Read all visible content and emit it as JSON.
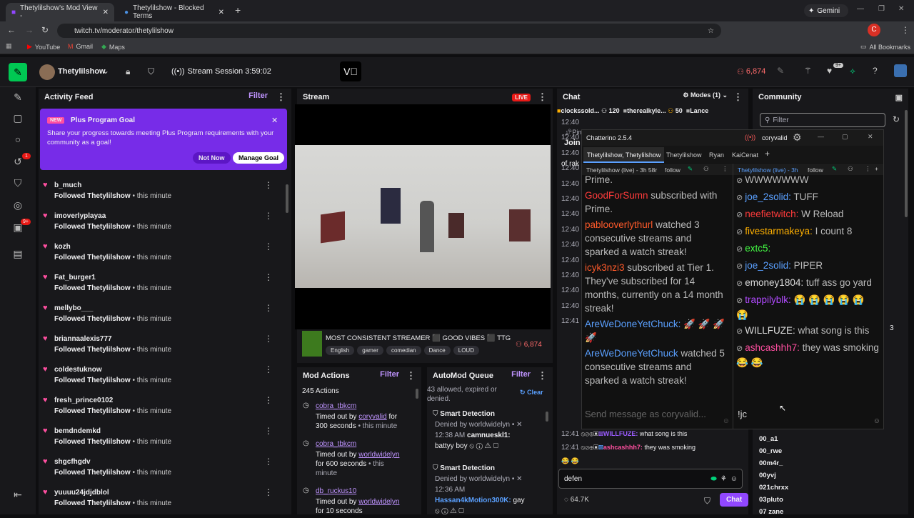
{
  "browser": {
    "tabs": [
      {
        "label": "Thetylilshow's Mod View -"
      },
      {
        "label": "Thetylilshow - Blocked Terms"
      }
    ],
    "url": "twitch.tv/moderator/thetylilshow",
    "gemini": "Gemini",
    "bookmarks": [
      "YouTube",
      "Gmail",
      "Maps"
    ],
    "all_bookmarks": "All Bookmarks",
    "profile_initial": "C"
  },
  "topnav": {
    "channel": "Thetylilshow",
    "session": "Stream Session 3:59:02",
    "viewers": "6,874",
    "notif_badge": "9+"
  },
  "rail": {
    "badge1": "1",
    "badge2": "9+"
  },
  "activity": {
    "title": "Activity Feed",
    "filter": "Filter",
    "goal_badge": "NEW",
    "goal_title": "Plus Program Goal",
    "goal_text": "Share your progress towards meeting Plus Program requirements with your community as a goal!",
    "not_now": "Not Now",
    "manage": "Manage Goal",
    "action": "Followed",
    "target": "Thetylilshow",
    "time": "• this minute",
    "items": [
      {
        "name": "b_much"
      },
      {
        "name": "imoverlyplayaa"
      },
      {
        "name": "kozh"
      },
      {
        "name": "Fat_burger1"
      },
      {
        "name": "mellybo___"
      },
      {
        "name": "briannaalexis777"
      },
      {
        "name": "coldestuknow"
      },
      {
        "name": "fresh_prince0102"
      },
      {
        "name": "bemdndemkd"
      },
      {
        "name": "shgcfhgdv"
      },
      {
        "name": "yuuuu24jdjdblol"
      }
    ]
  },
  "stream": {
    "title": "Stream",
    "live": "LIVE",
    "stream_title": "MOST CONSISTENT STREAMER ⬛ GOOD VIBES ⬛ TTG",
    "tags": [
      "English",
      "gamer",
      "comedian",
      "Dance",
      "LOUD"
    ],
    "viewers": "6,874"
  },
  "modactions": {
    "title": "Mod Actions",
    "filter": "Filter",
    "count": "245 Actions",
    "items": [
      {
        "user": "cobra_tbkcm",
        "l1": "Timed out by",
        "by": "coryvalid",
        "l1b": "for",
        "l2": "300 seconds",
        "time": "• this minute"
      },
      {
        "user": "cobra_tbkcm",
        "l1": "Timed out by",
        "by": "worldwidelyn",
        "l2": "for 600 seconds",
        "time": "• this",
        "l3": "minute"
      },
      {
        "user": "db_ruckus10",
        "l1": "Timed out by",
        "by": "worldwidelyn",
        "l2": "for 10 seconds"
      }
    ]
  },
  "automod": {
    "title": "AutoMod Queue",
    "filter": "Filter",
    "summary1": "43 allowed, expired or",
    "summary2": "denied.",
    "clear": "Clear",
    "items": [
      {
        "title": "Smart Detection",
        "denied": "Denied by worldwidelyn •",
        "time": "12:38 AM",
        "user": "camnueskl1:",
        "msg": "battyy boy"
      },
      {
        "title": "Smart Detection",
        "denied": "Denied by worldwidelyn •",
        "time": "12:36 AM",
        "user": "Hassan4kMotion300K:",
        "msg": "gay"
      }
    ]
  },
  "chat": {
    "title": "Chat",
    "modes": "Modes (1)",
    "pinned": [
      {
        "name": "clockssold...",
        "count": "120"
      },
      {
        "name": "therealkyle...",
        "count": "50"
      },
      {
        "name": "Lance"
      }
    ],
    "pin_label": "Pin",
    "join": "Join",
    "rak": "of rak",
    "times": [
      "12:40",
      "12:40",
      "12:40",
      "12:40",
      "12:40",
      "12:40",
      "12:40",
      "12:40",
      "12:40",
      "12:40",
      "12:40",
      "12:40",
      "12:40",
      "12:41"
    ],
    "bottom": [
      {
        "time": "12:41",
        "user": "WILLFUZE:",
        "msg": "what song is this"
      },
      {
        "time": "12:41",
        "user": "ashcashhh7:",
        "msg": "they was smoking"
      }
    ],
    "input": "defen",
    "viewers": "64.7K",
    "send": "Chat"
  },
  "community": {
    "title": "Community",
    "placeholder": "Filter",
    "users": [
      "00_a1",
      "00_rwe",
      "00m4r_",
      "00yvj",
      "021chrxx",
      "03pluto",
      "07 zane"
    ],
    "counter": "3"
  },
  "chatterino": {
    "title": "Chatterino 2.5.4",
    "account": "coryvalid",
    "tabs": [
      "Thetylilshow, Thetylilshow",
      "Thetylilshow",
      "Ryan",
      "KaiCenat"
    ],
    "left_head": "Thetylilshow (live) - 3h 58r",
    "follow": "follow",
    "right_head": "Thetylilshow (live) - 3h",
    "left": [
      {
        "u": "",
        "t": "Prime.",
        "c": "#999"
      },
      {
        "u": "GoodForSumn",
        "t": " subscribed with Prime.",
        "c": "#ff3b3b"
      },
      {
        "u": "pablooverlythurl",
        "t": " watched 3 consecutive streams and sparked a watch streak!",
        "c": "#ff5a2a"
      },
      {
        "u": "icyk3nzi3",
        "t": " subscribed at Tier 1. They've subscribed for 14 months, currently on a 14 month streak!",
        "c": "#ff5a2a"
      },
      {
        "u": "AreWeDoneYetChuck:",
        "t": " 🚀 🚀 🚀 🚀",
        "c": "#5aa0ff"
      },
      {
        "u": "AreWeDoneYetChuck",
        "t": " watched 5 consecutive streams and sparked a watch streak!",
        "c": "#5aa0ff"
      }
    ],
    "right": [
      {
        "u": "",
        "t": "WWWWWWW",
        "c": "#ddd"
      },
      {
        "u": "joe_2solid:",
        "t": " TUFF",
        "c": "#5aa0ff"
      },
      {
        "u": "neefietwitch:",
        "t": " W Reload",
        "c": "#ff3b3b"
      },
      {
        "u": "fivestarmakeya:",
        "t": " I count 8",
        "c": "#ffb000"
      },
      {
        "u": "extc5:",
        "t": "",
        "c": "#44ff44"
      },
      {
        "u": "joe_2solid:",
        "t": " PIPER",
        "c": "#5aa0ff"
      },
      {
        "u": "emoney1804:",
        "t": " tuff ass go yard",
        "c": "#ddd"
      },
      {
        "u": "trappilyblk:",
        "t": " 😭 😭 😭 😭 😭 😭",
        "c": "#b14aff"
      },
      {
        "u": "WILLFUZE:",
        "t": " what song is this",
        "c": "#ddd"
      },
      {
        "u": "ashcashhh7:",
        "t": " they was smoking 😂 😂",
        "c": "#ff4fa0"
      }
    ],
    "placeholder": "Send message as coryvalid...",
    "right_input": "!jc"
  }
}
